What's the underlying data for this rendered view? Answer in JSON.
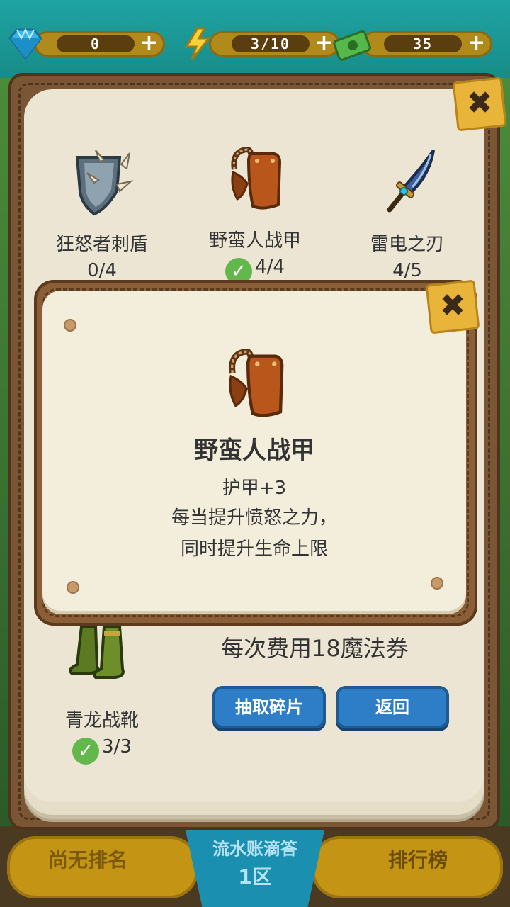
{
  "resources": [
    {
      "name": "diamond",
      "icon": "diamond-icon",
      "value": "0"
    },
    {
      "name": "energy",
      "icon": "lightning-icon",
      "value": "3/10"
    },
    {
      "name": "cash",
      "icon": "cash-icon",
      "value": "35"
    }
  ],
  "plus_label": "+",
  "close_label": "✖",
  "items": [
    {
      "name": "狂怒者刺盾",
      "count": "0/4",
      "owned": false,
      "icon": "spiked-shield-icon"
    },
    {
      "name": "野蛮人战甲",
      "count": "4/4",
      "owned": true,
      "icon": "barbarian-armor-icon"
    },
    {
      "name": "雷电之刃",
      "count": "4/5",
      "owned": false,
      "icon": "thunder-blade-icon"
    },
    {
      "name": "青龙战靴",
      "count": "3/3",
      "owned": true,
      "icon": "green-boots-icon"
    }
  ],
  "check_glyph": "✓",
  "cost_text": "每次费用18魔法券",
  "buttons": {
    "draw": "抽取碎片",
    "back": "返回"
  },
  "bottom": {
    "rank": "尚无排名",
    "server_name": "流水账滴答",
    "server_zone": "1区",
    "leaderboard": "排行榜"
  },
  "popup": {
    "title": "野蛮人战甲",
    "lines": [
      "护甲+3",
      "每当提升愤怒之力，",
      "同时提升生命上限"
    ],
    "icon": "barbarian-armor-icon"
  },
  "colors": {
    "button": "#2d7ec6",
    "check": "#62b84a",
    "gold": "#c49414"
  }
}
